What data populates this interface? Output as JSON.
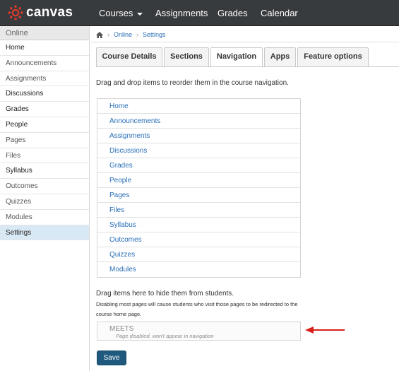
{
  "app": {
    "logo_text": "canvas",
    "logo_color": "#e4382a"
  },
  "topnav": {
    "items": [
      "Courses",
      "Assignments",
      "Grades",
      "Calendar"
    ]
  },
  "sidebar": {
    "header": "Online",
    "items": [
      {
        "label": "Home",
        "bold": true
      },
      {
        "label": "Announcements",
        "bold": false
      },
      {
        "label": "Assignments",
        "bold": false
      },
      {
        "label": "Discussions",
        "bold": true
      },
      {
        "label": "Grades",
        "bold": true
      },
      {
        "label": "People",
        "bold": true
      },
      {
        "label": "Pages",
        "bold": false
      },
      {
        "label": "Files",
        "bold": false
      },
      {
        "label": "Syllabus",
        "bold": true
      },
      {
        "label": "Outcomes",
        "bold": false
      },
      {
        "label": "Quizzes",
        "bold": false
      },
      {
        "label": "Modules",
        "bold": false
      },
      {
        "label": "Settings",
        "bold": true,
        "active": true
      }
    ]
  },
  "breadcrumb": {
    "items": [
      "Online",
      "Settings"
    ]
  },
  "tabs": [
    {
      "label": "Course Details",
      "active": false
    },
    {
      "label": "Sections",
      "active": false
    },
    {
      "label": "Navigation",
      "active": true
    },
    {
      "label": "Apps",
      "active": false
    },
    {
      "label": "Feature options",
      "active": false
    }
  ],
  "navigation": {
    "intro": "Drag and drop items to reorder them in the course navigation.",
    "items": [
      "Home",
      "Announcements",
      "Assignments",
      "Discussions",
      "Grades",
      "People",
      "Pages",
      "Files",
      "Syllabus",
      "Outcomes",
      "Quizzes",
      "Modules"
    ],
    "hide_title": "Drag items here to hide them from students.",
    "hide_note": "Disabling most pages will cause students who visit those pages to be redirected to the course home page.",
    "disabled_item": {
      "label": "MEETS",
      "note": "Page disabled, won't appear in navigation"
    },
    "save_label": "Save"
  },
  "annotation_arrow_color": "#d9201c"
}
